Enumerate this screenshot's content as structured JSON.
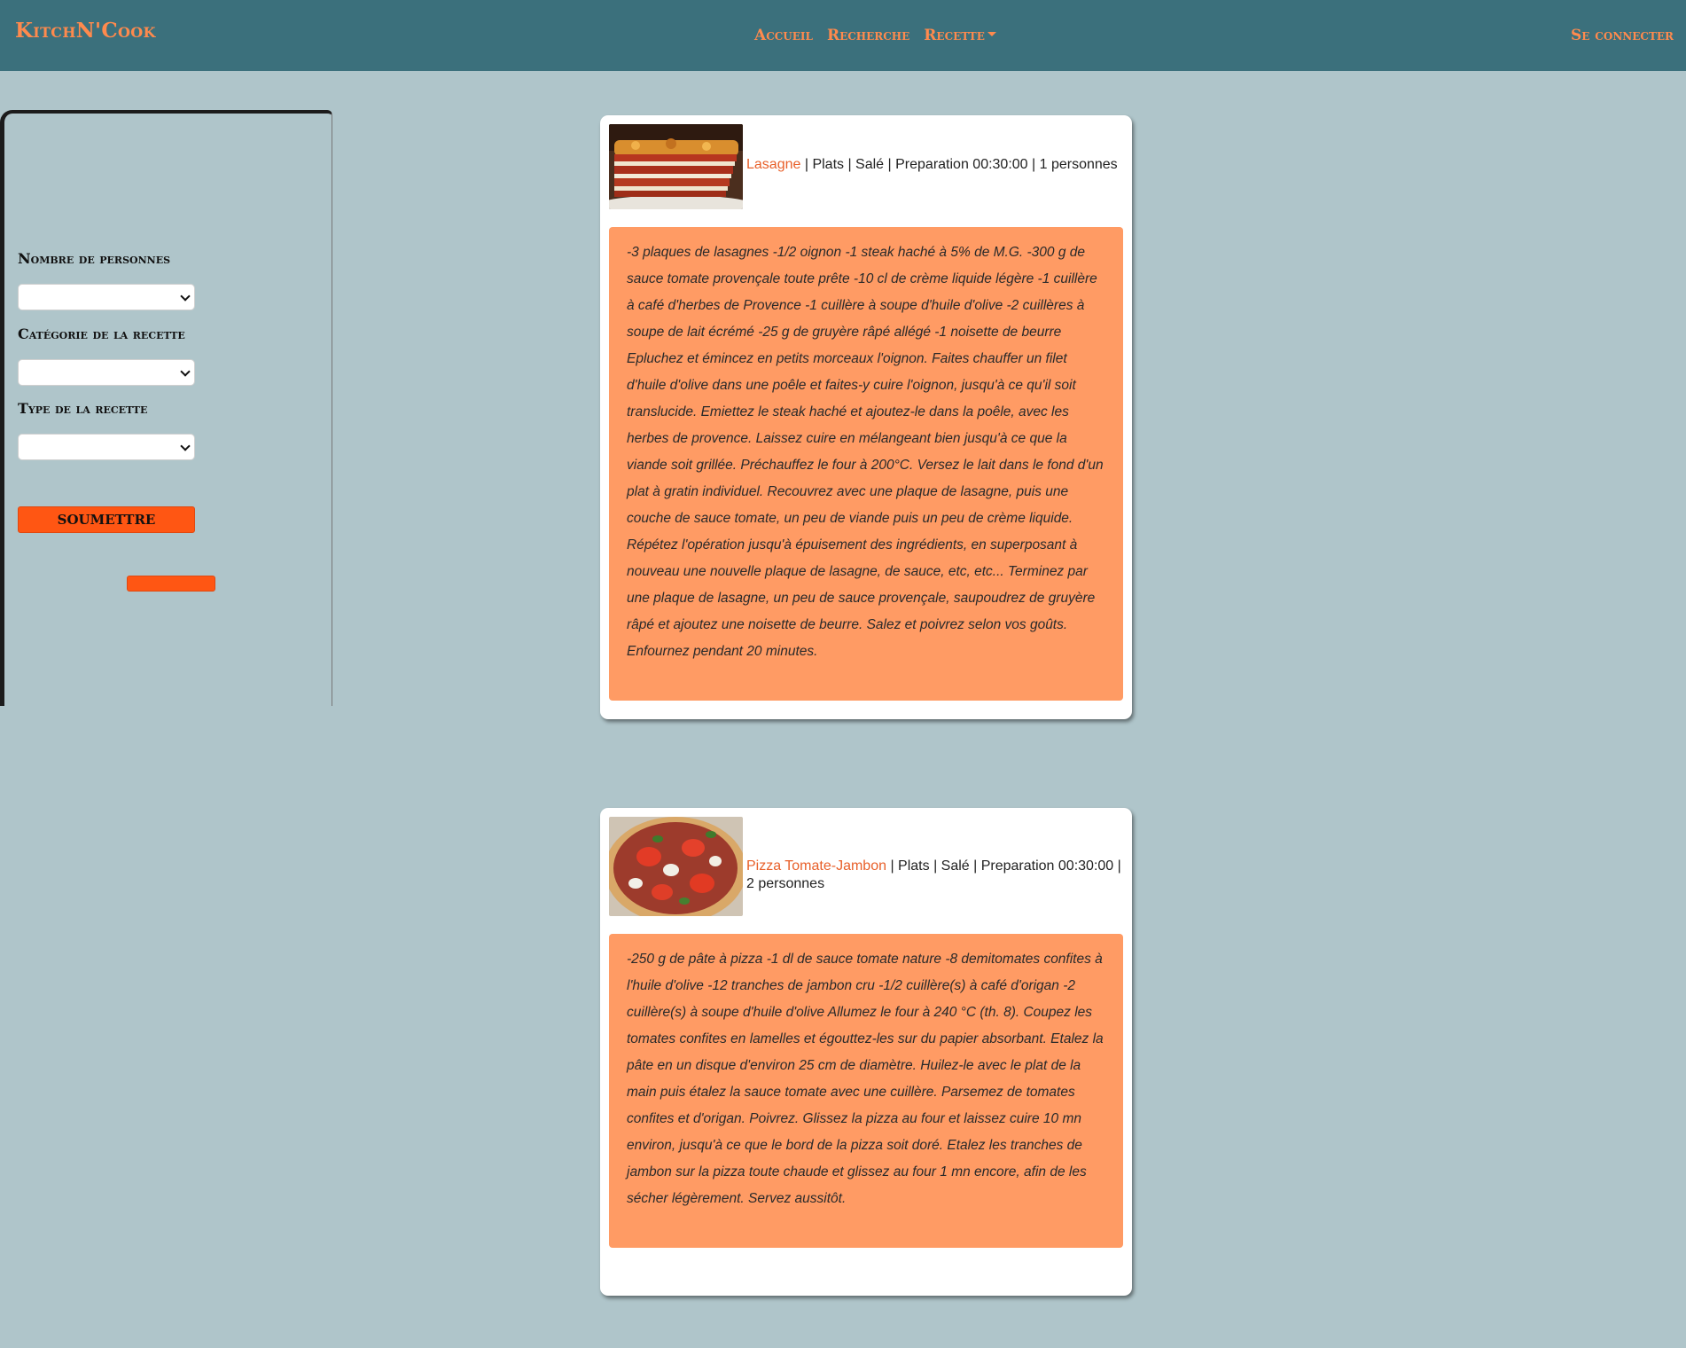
{
  "navbar": {
    "brand": "KitchN'Cook",
    "links": [
      "Accueil",
      "Recherche",
      "Recette"
    ],
    "login": "Se connecter"
  },
  "filters": {
    "persons_label": "Nombre de personnes",
    "category_label": "Catégorie de la recette",
    "type_label": "Type de la recette",
    "persons_value": "",
    "category_value": "",
    "type_value": "",
    "submit_label": "SOUMETTRE"
  },
  "recipes": [
    {
      "name": "Lasagne",
      "meta": " | Plats | Salé | Preparation 00:30:00 | 1 personnes",
      "image": "lasagna-photo",
      "description": "-3 plaques de lasagnes -1/2 oignon -1 steak haché à 5% de M.G. -300 g de sauce tomate provençale toute prête -10 cl de crème liquide légère -1 cuillère à café d'herbes de Provence -1 cuillère à soupe d'huile d'olive -2 cuillères à soupe de lait écrémé -25 g de gruyère râpé allégé -1 noisette de beurre Epluchez et émincez en petits morceaux l'oignon. Faites chauffer un filet d'huile d'olive dans une poêle et faites-y cuire l'oignon, jusqu'à ce qu'il soit translucide. Emiettez le steak haché et ajoutez-le dans la poêle, avec les herbes de provence. Laissez cuire en mélangeant bien jusqu'à ce que la viande soit grillée. Préchauffez le four à 200°C. Versez le lait dans le fond d'un plat à gratin individuel. Recouvrez avec une plaque de lasagne, puis une couche de sauce tomate, un peu de viande puis un peu de crème liquide. Répétez l'opération jusqu'à épuisement des ingrédients, en superposant à nouveau une nouvelle plaque de lasagne, de sauce, etc, etc... Terminez par une plaque de lasagne, un peu de sauce provençale, saupoudrez de gruyère râpé et ajoutez une noisette de beurre. Salez et poivrez selon vos goûts. Enfournez pendant 20 minutes."
    },
    {
      "name": "Pizza Tomate-Jambon",
      "meta": " | Plats | Salé | Preparation 00:30:00 | 2 personnes",
      "image": "pizza-photo",
      "description": "-250 g de pâte à pizza -1 dl de sauce tomate nature -8 demitomates confites à l'huile d'olive -12 tranches de jambon cru -1/2 cuillère(s) à café d'origan -2 cuillère(s) à soupe d'huile d'olive Allumez le four à 240 °C (th. 8). Coupez les tomates confites en lamelles et égouttez-les sur du papier absorbant. Etalez la pâte en un disque d'environ 25 cm de diamètre. Huilez-le avec le plat de la main puis étalez la sauce tomate avec une cuillère. Parsemez de tomates confites et d'origan. Poivrez. Glissez la pizza au four et laissez cuire 10 mn environ, jusqu'à ce que le bord de la pizza soit doré. Etalez les tranches de jambon sur la pizza toute chaude et glissez au four 1 mn encore, afin de les sécher légèrement. Servez aussitôt."
    }
  ]
}
